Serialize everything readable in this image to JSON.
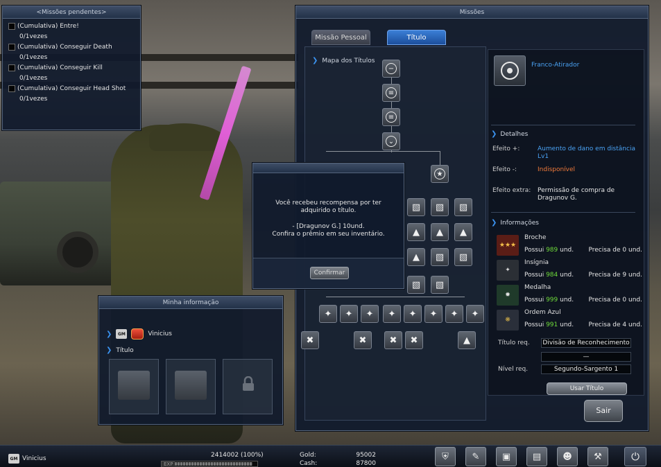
{
  "pending_missions": {
    "title": "<Missões pendentes>",
    "items": [
      {
        "name": "(Cumulativa)  Entre!",
        "progress": "0/1vezes"
      },
      {
        "name": "(Cumulativa)  Conseguir Death",
        "progress": "0/1vezes"
      },
      {
        "name": "(Cumulativa)  Conseguir Kill",
        "progress": "0/1vezes"
      },
      {
        "name": "(Cumulativa)  Conseguir Head Shot",
        "progress": "0/1vezes"
      }
    ]
  },
  "missions_window": {
    "title": "Missões",
    "tabs": [
      {
        "label": "Missão Pessoal",
        "active": false
      },
      {
        "label": "Título",
        "active": true
      }
    ],
    "tree_header": "Mapa dos Títulos",
    "selected_title": "Franco-Atirador",
    "details_header": "Detalhes",
    "effects": [
      {
        "label": "Efeito +:",
        "value": "Aumento de dano em distância Lv1",
        "color": "#4aa3f5"
      },
      {
        "label": "Efeito -:",
        "value": "Indisponível",
        "color": "#f07a3a"
      },
      {
        "label": "Efeito extra:",
        "value": "Permissão de compra de Dragunov G.",
        "color": "#e8e8e8"
      }
    ],
    "info_header": "Informações",
    "items": [
      {
        "name": "Broche",
        "have_label": "Possui",
        "have": "989",
        "unit": "und.",
        "need": "Precisa de 0 und."
      },
      {
        "name": "Insígnia",
        "have_label": "Possui",
        "have": "984",
        "unit": "und.",
        "need": "Precisa de 9 und."
      },
      {
        "name": "Medalha",
        "have_label": "Possui",
        "have": "999",
        "unit": "und.",
        "need": "Precisa de 0 und."
      },
      {
        "name": "Ordem Azul",
        "have_label": "Possui",
        "have": "991",
        "unit": "und.",
        "need": "Precisa de 4 und."
      }
    ],
    "title_req_label": "Título req.",
    "title_req_value": "Divisão de Reconhecimento",
    "title_req_value2": "—",
    "level_req_label": "Nível req.",
    "level_req_value": "Segundo-Sargento 1",
    "use_title_button": "Usar Título",
    "exit_button": "Sair"
  },
  "reward_dialog": {
    "line1": "Você recebeu recompensa por ter",
    "line2": "adquirido o título.",
    "line3": "- [Dragunov G.] 10und.",
    "line4": "Confira o prêmio em seu inventário.",
    "confirm_button": "Confirmar"
  },
  "my_info": {
    "title": "Minha informação",
    "gm_badge": "GM",
    "username": "Vinicius",
    "title_label": "Título"
  },
  "bottom_bar": {
    "gm_badge": "GM",
    "username": "Vinicius",
    "exp_value": "2414002 (100%)",
    "exp_label": "EXP",
    "exp_progress": 1.0,
    "gold_label": "Gold:",
    "gold_value": "95002",
    "cash_label": "Cash:",
    "cash_value": "87800"
  },
  "colors": {
    "accent_blue": "#4aa3f5",
    "negative_orange": "#f07a3a",
    "owned_green": "#6fdc3a"
  }
}
